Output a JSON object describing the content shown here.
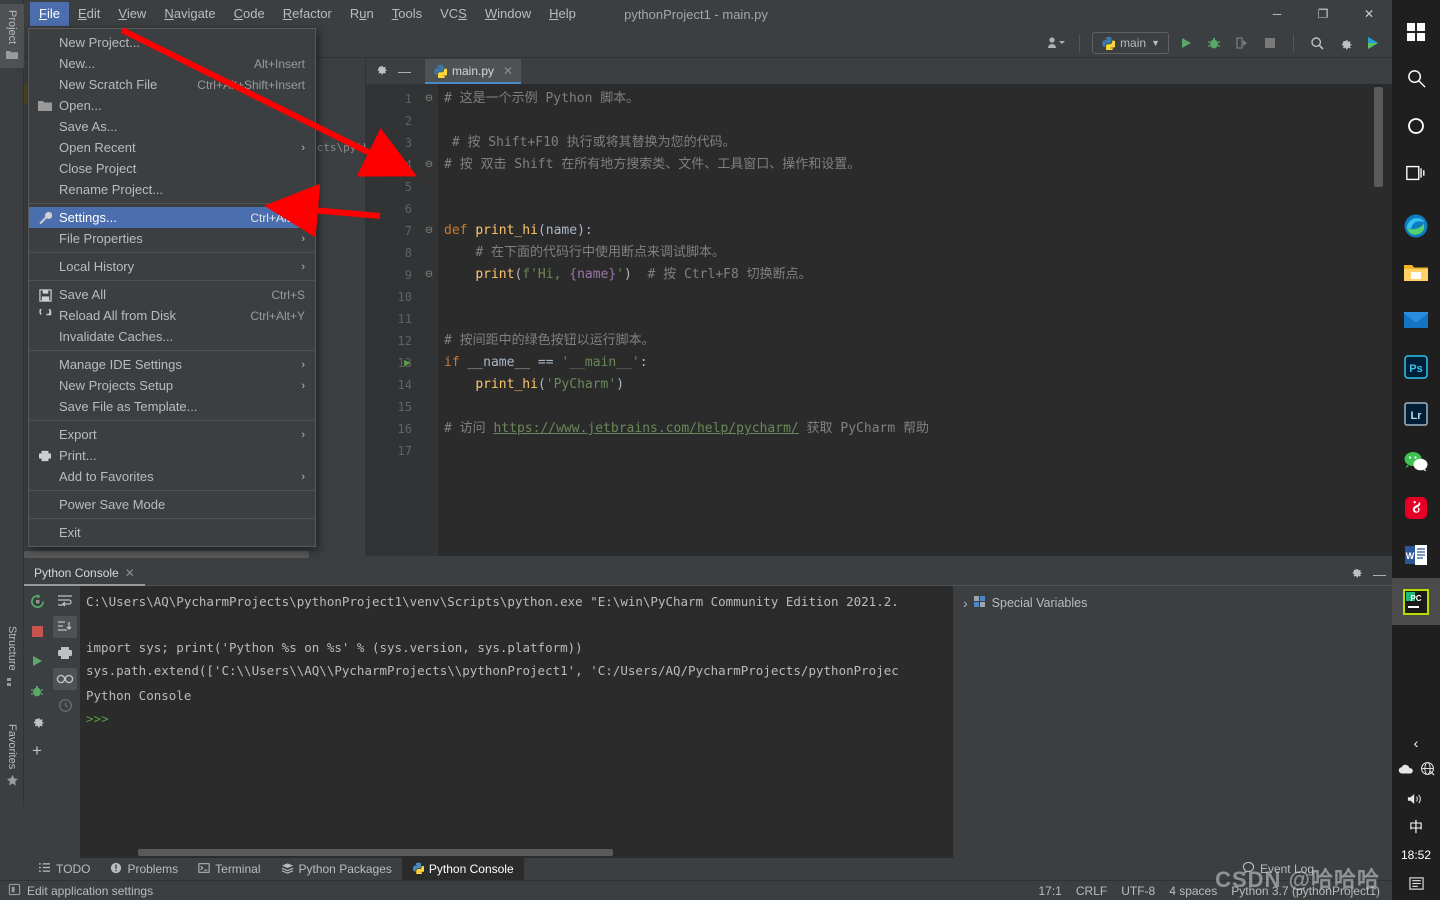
{
  "window": {
    "title": "pythonProject1 - main.py",
    "app_badge": "PC",
    "minimize": "─",
    "maximize": "❐",
    "close": "✕"
  },
  "menubar": [
    {
      "label": "File",
      "mnemonic": "F",
      "open": true
    },
    {
      "label": "Edit",
      "mnemonic": "E",
      "open": false
    },
    {
      "label": "View",
      "mnemonic": "V",
      "open": false
    },
    {
      "label": "Navigate",
      "mnemonic": "N",
      "open": false
    },
    {
      "label": "Code",
      "mnemonic": "C",
      "open": false
    },
    {
      "label": "Refactor",
      "mnemonic": "R",
      "open": false
    },
    {
      "label": "Run",
      "mnemonic": "u",
      "open": false
    },
    {
      "label": "Tools",
      "mnemonic": "T",
      "open": false
    },
    {
      "label": "VCS",
      "mnemonic": "S",
      "open": false
    },
    {
      "label": "Window",
      "mnemonic": "W",
      "open": false
    },
    {
      "label": "Help",
      "mnemonic": "H",
      "open": false
    }
  ],
  "file_menu": {
    "items": [
      {
        "label": "New Project...",
        "accel": "",
        "submenu": false,
        "icon": "",
        "selected": false
      },
      {
        "label": "New...",
        "accel": "Alt+Insert",
        "submenu": false,
        "icon": "",
        "selected": false
      },
      {
        "label": "New Scratch File",
        "accel": "Ctrl+Alt+Shift+Insert",
        "submenu": false,
        "icon": "",
        "selected": false
      },
      {
        "label": "Open...",
        "accel": "",
        "submenu": false,
        "icon": "folder-icon",
        "selected": false
      },
      {
        "label": "Save As...",
        "accel": "",
        "submenu": false,
        "icon": "",
        "selected": false
      },
      {
        "label": "Open Recent",
        "accel": "",
        "submenu": true,
        "icon": "",
        "selected": false
      },
      {
        "label": "Close Project",
        "accel": "",
        "submenu": false,
        "icon": "",
        "selected": false
      },
      {
        "label": "Rename Project...",
        "accel": "",
        "submenu": false,
        "icon": "",
        "selected": false
      },
      {
        "separator": true
      },
      {
        "label": "Settings...",
        "accel": "Ctrl+Alt+S",
        "submenu": false,
        "icon": "wrench-icon",
        "selected": true
      },
      {
        "label": "File Properties",
        "accel": "",
        "submenu": true,
        "icon": "",
        "selected": false
      },
      {
        "separator": true
      },
      {
        "label": "Local History",
        "accel": "",
        "submenu": true,
        "icon": "",
        "selected": false
      },
      {
        "separator": true
      },
      {
        "label": "Save All",
        "accel": "Ctrl+S",
        "submenu": false,
        "icon": "save-icon",
        "selected": false
      },
      {
        "label": "Reload All from Disk",
        "accel": "Ctrl+Alt+Y",
        "submenu": false,
        "icon": "refresh-icon",
        "selected": false
      },
      {
        "label": "Invalidate Caches...",
        "accel": "",
        "submenu": false,
        "icon": "",
        "selected": false
      },
      {
        "separator": true
      },
      {
        "label": "Manage IDE Settings",
        "accel": "",
        "submenu": true,
        "icon": "",
        "selected": false
      },
      {
        "label": "New Projects Setup",
        "accel": "",
        "submenu": true,
        "icon": "",
        "selected": false
      },
      {
        "label": "Save File as Template...",
        "accel": "",
        "submenu": false,
        "icon": "",
        "selected": false
      },
      {
        "separator": true
      },
      {
        "label": "Export",
        "accel": "",
        "submenu": true,
        "icon": "",
        "selected": false
      },
      {
        "label": "Print...",
        "accel": "",
        "submenu": false,
        "icon": "printer-icon",
        "selected": false
      },
      {
        "label": "Add to Favorites",
        "accel": "",
        "submenu": true,
        "icon": "",
        "selected": false
      },
      {
        "separator": true
      },
      {
        "label": "Power Save Mode",
        "accel": "",
        "submenu": false,
        "icon": "",
        "selected": false
      },
      {
        "separator": true
      },
      {
        "label": "Exit",
        "accel": "",
        "submenu": false,
        "icon": "",
        "selected": false
      }
    ]
  },
  "toolbar": {
    "run_config": "main",
    "run_config_icon": "python-icon",
    "buttons": [
      "run-icon",
      "debug-icon",
      "coverage-icon",
      "stop-icon",
      "search-icon",
      "settings-icon",
      "updates-icon"
    ],
    "account_icon": "account-icon"
  },
  "left_strip": {
    "project": "Project",
    "structure": "Structure",
    "favorites": "Favorites"
  },
  "project_panel": {
    "breadcrumb": "ects\\pyth"
  },
  "editor": {
    "tab_label": "main.py",
    "tab_icon": "python-file-icon",
    "inspection_status": "✓",
    "lines": [
      {
        "num": "1",
        "fold": "⊖",
        "html": "<span class='c-com'># 这是一个示例 Python 脚本。</span>"
      },
      {
        "num": "2",
        "fold": "",
        "html": ""
      },
      {
        "num": "3",
        "fold": "",
        "html": " <span class='c-com'># 按 Shift+F10 执行或将其替换为您的代码。</span>"
      },
      {
        "num": "4",
        "fold": "⊖",
        "html": "<span class='c-com'># 按 双击 Shift 在所有地方搜索类、文件、工具窗口、操作和设置。</span>"
      },
      {
        "num": "5",
        "fold": "",
        "html": ""
      },
      {
        "num": "6",
        "fold": "",
        "html": ""
      },
      {
        "num": "7",
        "fold": "⊖",
        "html": "<span class='c-kw'>def</span> <span class='c-fn'>print_hi</span>(<span class='c-var'>name</span>):"
      },
      {
        "num": "8",
        "fold": "",
        "html": "    <span class='c-com'># 在下面的代码行中使用断点来调试脚本。</span>"
      },
      {
        "num": "9",
        "fold": "⊖",
        "html": "    <span class='c-fn'>print</span>(<span class='c-str'>f'Hi, </span><span class='c-ident'>{name}</span><span class='c-str'>'</span>)  <span class='c-com'># 按 Ctrl+F8 切换断点。</span>"
      },
      {
        "num": "10",
        "fold": "",
        "html": ""
      },
      {
        "num": "11",
        "fold": "",
        "html": ""
      },
      {
        "num": "12",
        "fold": "",
        "html": "<span class='c-com'># 按间距中的绿色按钮以运行脚本。</span>"
      },
      {
        "num": "13",
        "fold": "",
        "html": "<span class='c-kw'>if</span> __name__ == <span class='c-str'>'__main__'</span>:",
        "gutter_run": true
      },
      {
        "num": "14",
        "fold": "",
        "html": "    <span class='c-fn'>print_hi</span>(<span class='c-str'>'PyCharm'</span>)"
      },
      {
        "num": "15",
        "fold": "",
        "html": ""
      },
      {
        "num": "16",
        "fold": "",
        "html": "<span class='c-com'># 访问 </span><span class='c-link'>https://www.jetbrains.com/help/pycharm/</span><span class='c-com'> 获取 PyCharm 帮助</span>"
      },
      {
        "num": "17",
        "fold": "",
        "html": ""
      }
    ]
  },
  "console": {
    "tab_label": "Python Console",
    "tab_close": "✕",
    "settings_icon": "gear-icon",
    "hide_icon": "minimize-icon",
    "toolbar_left": [
      "rerun-icon",
      "stop-icon",
      "execute-icon",
      "debug-icon",
      "settings-icon",
      "add-icon"
    ],
    "toolbar_right": [
      "soft-wrap-icon",
      "scroll-to-end-icon",
      "print-icon",
      "show-variables-icon",
      "history-icon"
    ],
    "output": [
      "C:\\Users\\AQ\\PycharmProjects\\pythonProject1\\venv\\Scripts\\python.exe \"E:\\win\\PyCharm Community Edition 2021.2.",
      "",
      "import sys; print('Python %s on %s' % (sys.version, sys.platform))",
      "sys.path.extend(['C:\\\\Users\\\\AQ\\\\PycharmProjects\\\\pythonProject1', 'C:/Users/AQ/PycharmProjects/pythonProjec"
    ],
    "banner": "Python Console",
    "prompt": ">>>",
    "special_variables": {
      "chevron": "›",
      "icon": "variables-icon",
      "label": "Special Variables"
    }
  },
  "bottom_tabs": [
    {
      "label": "TODO",
      "icon": "todo-icon",
      "active": false
    },
    {
      "label": "Problems",
      "icon": "problems-icon",
      "active": false
    },
    {
      "label": "Terminal",
      "icon": "terminal-icon",
      "active": false
    },
    {
      "label": "Python Packages",
      "icon": "packages-icon",
      "active": false
    },
    {
      "label": "Python Console",
      "icon": "python-console-icon",
      "active": true
    }
  ],
  "event_log": {
    "label": "Event Log",
    "icon": "balloon-icon"
  },
  "statusbar": {
    "hint_icon": "app-settings-icon",
    "hint": "Edit application settings",
    "caret": "17:1",
    "line_sep": "CRLF",
    "encoding": "UTF-8",
    "indent": "4 spaces",
    "interpreter": "Python 3.7 (pythonProject1)"
  },
  "taskbar": {
    "icons": [
      {
        "name": "windows-start-icon"
      },
      {
        "name": "search-icon"
      },
      {
        "name": "cortana-icon"
      },
      {
        "name": "task-view-icon"
      },
      {
        "name": "edge-icon"
      },
      {
        "name": "file-explorer-icon"
      },
      {
        "name": "mail-icon"
      },
      {
        "name": "photoshop-icon",
        "label": "Ps"
      },
      {
        "name": "lightroom-icon",
        "label": "Lr"
      },
      {
        "name": "wechat-icon"
      },
      {
        "name": "netease-music-icon"
      },
      {
        "name": "word-icon",
        "label": "W"
      },
      {
        "name": "pycharm-icon",
        "label": "PC",
        "active": true
      }
    ],
    "tray": {
      "expand": "‹",
      "onedrive": "cloud-icon",
      "network": "network-icon",
      "volume": "volume-icon",
      "ime": "中",
      "time": "18:52",
      "notifications": "notification-icon"
    }
  },
  "watermark": "CSDN @哈哈哈",
  "colors": {
    "accent": "#4b6eaf",
    "tab_underline": "#4a88c7",
    "annotation": "#ff0000",
    "run_green": "#5c9d46",
    "panel": "#3c3f41",
    "editor_bg": "#2b2b2b"
  }
}
